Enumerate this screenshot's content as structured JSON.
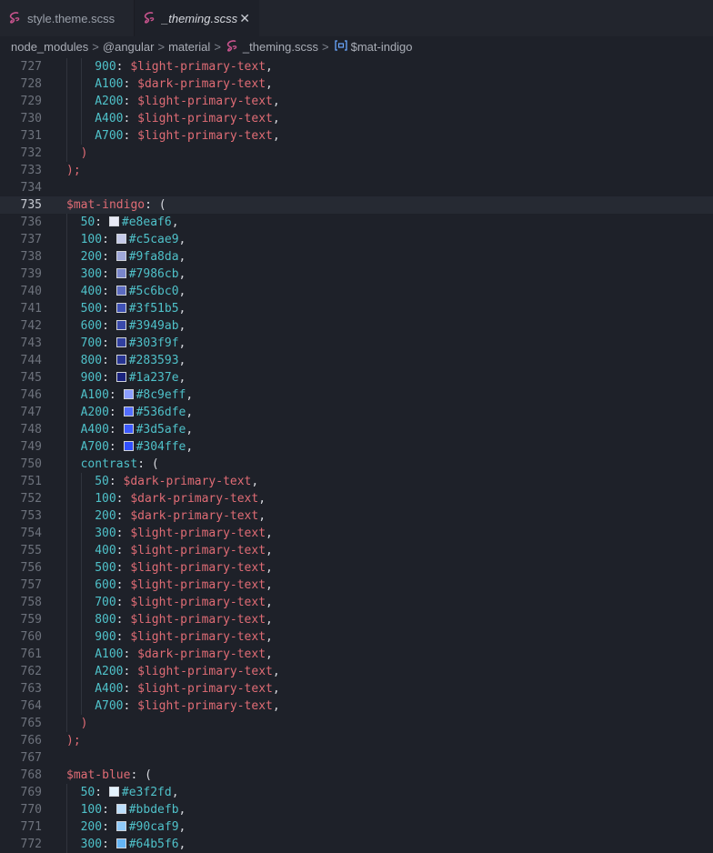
{
  "tabs": [
    {
      "label": "style.theme.scss",
      "active": false
    },
    {
      "label": "_theming.scss",
      "active": true
    }
  ],
  "tab_close_glyph": "✕",
  "breadcrumb": {
    "items": [
      "node_modules",
      "@angular",
      "material",
      "_theming.scss",
      "$mat-indigo"
    ],
    "separator": ">"
  },
  "colors": {
    "sass_icon": "#c6538c",
    "variable": "#e06c75",
    "key": "#4fc1c9"
  },
  "lines": [
    {
      "n": "727",
      "indent": 2,
      "key": "900",
      "var": "$light-primary-text",
      "end": ","
    },
    {
      "n": "728",
      "indent": 2,
      "key": "A100",
      "var": "$dark-primary-text",
      "end": ","
    },
    {
      "n": "729",
      "indent": 2,
      "key": "A200",
      "var": "$light-primary-text",
      "end": ","
    },
    {
      "n": "730",
      "indent": 2,
      "key": "A400",
      "var": "$light-primary-text",
      "end": ","
    },
    {
      "n": "731",
      "indent": 2,
      "key": "A700",
      "var": "$light-primary-text",
      "end": ","
    },
    {
      "n": "732",
      "indent": 1,
      "punct": ")"
    },
    {
      "n": "733",
      "indent": 0,
      "punct": ");"
    },
    {
      "n": "734",
      "indent": 0
    },
    {
      "n": "735",
      "indent": 0,
      "decl": "$mat-indigo",
      "open": ": (",
      "active": true
    },
    {
      "n": "736",
      "indent": 1,
      "key": "50",
      "color": "#e8eaf6",
      "end": ","
    },
    {
      "n": "737",
      "indent": 1,
      "key": "100",
      "color": "#c5cae9",
      "end": ","
    },
    {
      "n": "738",
      "indent": 1,
      "key": "200",
      "color": "#9fa8da",
      "end": ","
    },
    {
      "n": "739",
      "indent": 1,
      "key": "300",
      "color": "#7986cb",
      "end": ","
    },
    {
      "n": "740",
      "indent": 1,
      "key": "400",
      "color": "#5c6bc0",
      "end": ","
    },
    {
      "n": "741",
      "indent": 1,
      "key": "500",
      "color": "#3f51b5",
      "end": ","
    },
    {
      "n": "742",
      "indent": 1,
      "key": "600",
      "color": "#3949ab",
      "end": ","
    },
    {
      "n": "743",
      "indent": 1,
      "key": "700",
      "color": "#303f9f",
      "end": ","
    },
    {
      "n": "744",
      "indent": 1,
      "key": "800",
      "color": "#283593",
      "end": ","
    },
    {
      "n": "745",
      "indent": 1,
      "key": "900",
      "color": "#1a237e",
      "end": ","
    },
    {
      "n": "746",
      "indent": 1,
      "key": "A100",
      "color": "#8c9eff",
      "end": ","
    },
    {
      "n": "747",
      "indent": 1,
      "key": "A200",
      "color": "#536dfe",
      "end": ","
    },
    {
      "n": "748",
      "indent": 1,
      "key": "A400",
      "color": "#3d5afe",
      "end": ","
    },
    {
      "n": "749",
      "indent": 1,
      "key": "A700",
      "color": "#304ffe",
      "end": ","
    },
    {
      "n": "750",
      "indent": 1,
      "key": "contrast",
      "open": " ("
    },
    {
      "n": "751",
      "indent": 2,
      "key": "50",
      "var": "$dark-primary-text",
      "end": ","
    },
    {
      "n": "752",
      "indent": 2,
      "key": "100",
      "var": "$dark-primary-text",
      "end": ","
    },
    {
      "n": "753",
      "indent": 2,
      "key": "200",
      "var": "$dark-primary-text",
      "end": ","
    },
    {
      "n": "754",
      "indent": 2,
      "key": "300",
      "var": "$light-primary-text",
      "end": ","
    },
    {
      "n": "755",
      "indent": 2,
      "key": "400",
      "var": "$light-primary-text",
      "end": ","
    },
    {
      "n": "756",
      "indent": 2,
      "key": "500",
      "var": "$light-primary-text",
      "end": ","
    },
    {
      "n": "757",
      "indent": 2,
      "key": "600",
      "var": "$light-primary-text",
      "end": ","
    },
    {
      "n": "758",
      "indent": 2,
      "key": "700",
      "var": "$light-primary-text",
      "end": ","
    },
    {
      "n": "759",
      "indent": 2,
      "key": "800",
      "var": "$light-primary-text",
      "end": ","
    },
    {
      "n": "760",
      "indent": 2,
      "key": "900",
      "var": "$light-primary-text",
      "end": ","
    },
    {
      "n": "761",
      "indent": 2,
      "key": "A100",
      "var": "$dark-primary-text",
      "end": ","
    },
    {
      "n": "762",
      "indent": 2,
      "key": "A200",
      "var": "$light-primary-text",
      "end": ","
    },
    {
      "n": "763",
      "indent": 2,
      "key": "A400",
      "var": "$light-primary-text",
      "end": ","
    },
    {
      "n": "764",
      "indent": 2,
      "key": "A700",
      "var": "$light-primary-text",
      "end": ","
    },
    {
      "n": "765",
      "indent": 1,
      "punct": ")"
    },
    {
      "n": "766",
      "indent": 0,
      "punct": ");"
    },
    {
      "n": "767",
      "indent": 0
    },
    {
      "n": "768",
      "indent": 0,
      "decl": "$mat-blue",
      "open": ": ("
    },
    {
      "n": "769",
      "indent": 1,
      "key": "50",
      "color": "#e3f2fd",
      "end": ","
    },
    {
      "n": "770",
      "indent": 1,
      "key": "100",
      "color": "#bbdefb",
      "end": ","
    },
    {
      "n": "771",
      "indent": 1,
      "key": "200",
      "color": "#90caf9",
      "end": ","
    },
    {
      "n": "772",
      "indent": 1,
      "key": "300",
      "color": "#64b5f6",
      "end": ","
    }
  ]
}
